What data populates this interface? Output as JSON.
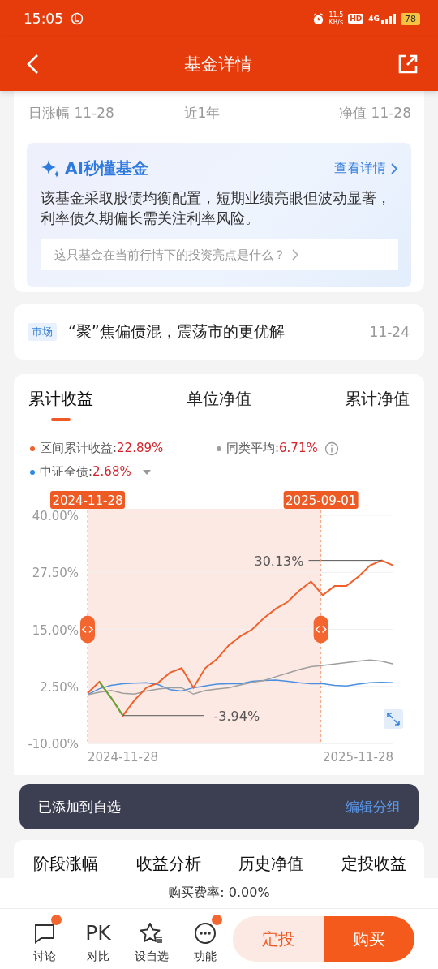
{
  "status_bar": {
    "time": "15:05",
    "net_speed": "11.5",
    "net_unit": "KB/s",
    "hd": "HD",
    "network": "4G",
    "battery": "78"
  },
  "header": {
    "title": "基金详情"
  },
  "stats": [
    {
      "label": "日涨幅 11-28"
    },
    {
      "label": "近1年"
    },
    {
      "label": "净值 11-28"
    }
  ],
  "ai_card": {
    "title": "AI秒懂基金",
    "link": "查看详情",
    "summary": "该基金采取股债均衡配置，短期业绩亮眼但波动显著，利率债久期偏长需关注利率风险。",
    "question": "这只基金在当前行情下的投资亮点是什么？"
  },
  "news": {
    "tag": "市场",
    "headline": "“聚”焦偏债混，震荡市的更优解",
    "date": "11-24"
  },
  "chart_tabs": [
    {
      "label": "累计收益",
      "selected": true
    },
    {
      "label": "单位净值",
      "selected": false
    },
    {
      "label": "累计净值",
      "selected": false
    }
  ],
  "legend": [
    {
      "value": "22.89%",
      "color": "#f0602a"
    },
    {
      "value": "6.71%",
      "color": "#9e9e9e",
      "info": true
    },
    {
      "value": "2.68%",
      "color": "#2f88e8",
      "dropdown": true
    }
  ],
  "range": {
    "start": "2024-11-28",
    "end": "2025-09-01"
  },
  "chart_data": {
    "type": "line",
    "categories": [
      null,
      null,
      null,
      "2024-11-28",
      null,
      null,
      null,
      null,
      null,
      null,
      null,
      null,
      null,
      null,
      null,
      null,
      null,
      null,
      null,
      null,
      null,
      null,
      null,
      "2025-11-28",
      null,
      null,
      null
    ],
    "grid": true,
    "ylim": [
      -10,
      40
    ],
    "yticks": [
      {
        "value": 40,
        "label": "40.00%"
      },
      {
        "value": 27.5,
        "label": "27.50%"
      },
      {
        "value": 15,
        "label": "15.00%"
      },
      {
        "value": 2.5,
        "label": "2.50%"
      },
      {
        "value": -10,
        "label": "-10.00%"
      }
    ],
    "series": [
      {
        "name": "区间累计收益:",
        "color": "#f0602a",
        "values": [
          1,
          3.5,
          0,
          -3.9,
          -0.5,
          2.2,
          3.3,
          5.5,
          6.5,
          2.2,
          6.5,
          8.5,
          11.5,
          13.5,
          15,
          17.5,
          19.5,
          21,
          23.5,
          25.5,
          22.5,
          24.5,
          24.5,
          26.5,
          29,
          30.1,
          29
        ]
      },
      {
        "name": "同类平均:",
        "color": "#9e9e9e",
        "values": [
          0.7,
          1.2,
          1.6,
          1,
          0.8,
          1.5,
          1.9,
          2.2,
          2.2,
          0.8,
          1.6,
          1.9,
          2.2,
          2.8,
          3.4,
          3.8,
          4.6,
          5.4,
          6.2,
          6.8,
          7.1,
          7.4,
          7.7,
          8,
          8.3,
          8,
          7.4
        ]
      },
      {
        "name": "中证全债:",
        "color": "#4a8fe0",
        "values": [
          0.7,
          2,
          2.7,
          3.1,
          3.2,
          3.3,
          2.9,
          1.8,
          1.5,
          2.2,
          2.6,
          3,
          3.1,
          3.1,
          3.6,
          3.8,
          3.9,
          3.6,
          3.3,
          3.1,
          3.1,
          2.7,
          2.6,
          3,
          3.3,
          3.4,
          3.3
        ]
      }
    ],
    "annotations": [
      "30.13%",
      "-3.94%"
    ]
  },
  "toast": {
    "text": "已添加到自选",
    "action": "编辑分组"
  },
  "section_tabs": [
    {
      "label": "阶段涨幅"
    },
    {
      "label": "收益分析"
    },
    {
      "label": "历史净值"
    },
    {
      "label": "定投收益"
    }
  ],
  "fee": "购买费率: 0.00%",
  "bottom_nav": [
    {
      "label": "讨论",
      "kind": "chat",
      "badge": true
    },
    {
      "label": "对比",
      "kind": "text",
      "icon_text": "PK",
      "badge": false
    },
    {
      "label": "设自选",
      "kind": "star",
      "badge": false
    },
    {
      "label": "功能",
      "kind": "more",
      "badge": true
    }
  ],
  "actions": [
    {
      "label": "定投",
      "kind": "secondary"
    },
    {
      "label": "购买",
      "kind": "primary"
    }
  ]
}
